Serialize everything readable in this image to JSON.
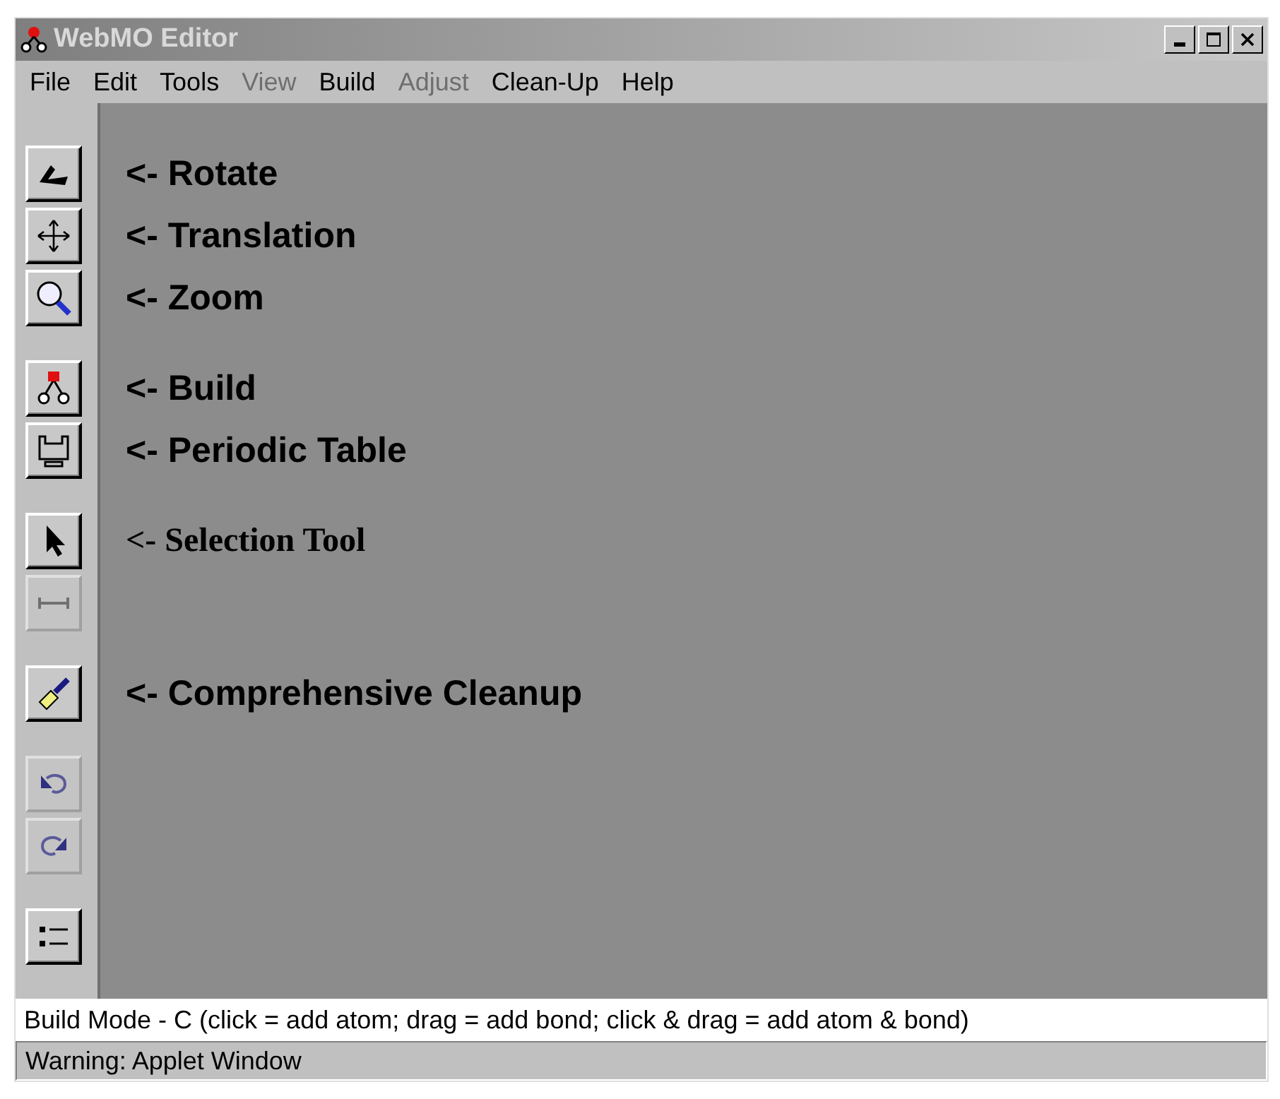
{
  "window": {
    "title": "WebMO Editor"
  },
  "menu": [
    {
      "label": "File",
      "disabled": false
    },
    {
      "label": "Edit",
      "disabled": false
    },
    {
      "label": "Tools",
      "disabled": false
    },
    {
      "label": "View",
      "disabled": true
    },
    {
      "label": "Build",
      "disabled": false
    },
    {
      "label": "Adjust",
      "disabled": true
    },
    {
      "label": "Clean-Up",
      "disabled": false
    },
    {
      "label": "Help",
      "disabled": false
    }
  ],
  "toolbar": [
    {
      "tools": [
        {
          "kind": "rotate",
          "disabled": false,
          "annotation": "<- Rotate"
        },
        {
          "kind": "translate",
          "disabled": false,
          "annotation": "<- Translation"
        },
        {
          "kind": "zoom",
          "disabled": false,
          "annotation": "<- Zoom"
        }
      ]
    },
    {
      "tools": [
        {
          "kind": "build",
          "disabled": false,
          "annotation": "<- Build"
        },
        {
          "kind": "periodic",
          "disabled": false,
          "annotation": "<- Periodic Table"
        }
      ]
    },
    {
      "tools": [
        {
          "kind": "select",
          "disabled": false,
          "annotation": "<- Selection Tool"
        },
        {
          "kind": "measure",
          "disabled": true
        }
      ]
    },
    {
      "tools": [
        {
          "kind": "cleanup",
          "disabled": false,
          "annotation": "<- Comprehensive Cleanup"
        }
      ]
    },
    {
      "tools": [
        {
          "kind": "undo",
          "disabled": true
        },
        {
          "kind": "redo",
          "disabled": true
        }
      ]
    },
    {
      "tools": [
        {
          "kind": "list",
          "disabled": false
        }
      ]
    }
  ],
  "status_bar": "Build Mode - C (click = add atom; drag = add bond; click & drag = add atom & bond)",
  "warning_bar": "Warning: Applet Window"
}
